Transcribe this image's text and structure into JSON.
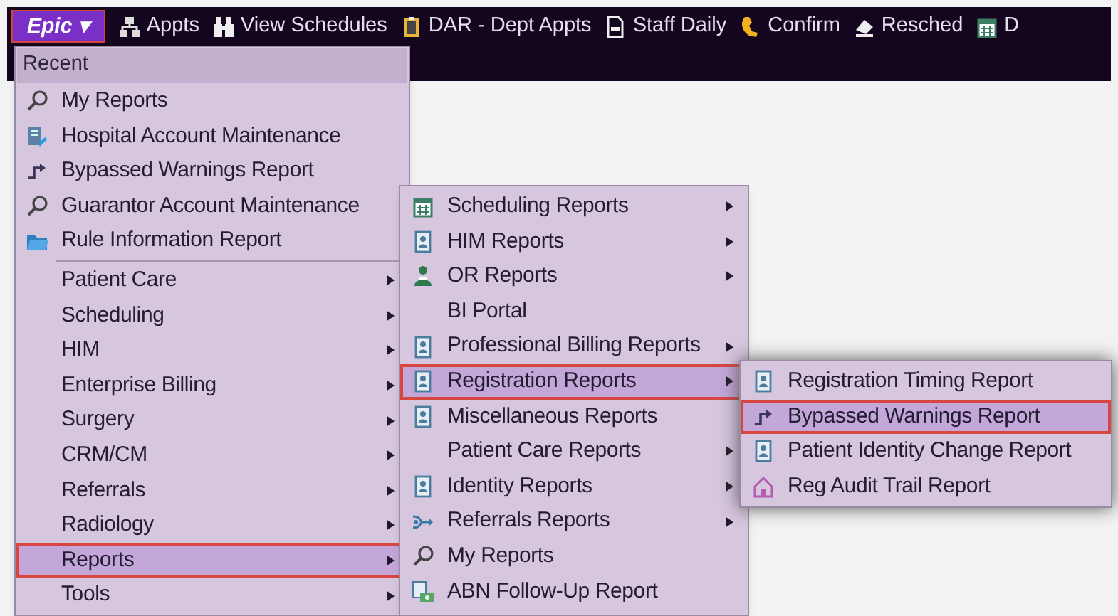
{
  "toolbar": [
    {
      "kind": "epic",
      "label": "Epic ▾"
    },
    {
      "kind": "network",
      "label": "Appts"
    },
    {
      "kind": "binoculars",
      "label": "View Schedules"
    },
    {
      "kind": "clipboard",
      "label": "DAR - Dept Appts"
    },
    {
      "kind": "document",
      "label": "Staff Daily"
    },
    {
      "kind": "phone",
      "label": "Confirm"
    },
    {
      "kind": "eraser",
      "label": "Resched"
    },
    {
      "kind": "calendar",
      "label": "D"
    }
  ],
  "main_menu": {
    "header": "Recent",
    "recent": [
      {
        "kind": "search",
        "label": "My Reports"
      },
      {
        "kind": "edit",
        "label": "Hospital Account Maintenance"
      },
      {
        "kind": "bypass",
        "label": "Bypassed Warnings Report"
      },
      {
        "kind": "search",
        "label": "Guarantor Account Maintenance"
      },
      {
        "kind": "folder",
        "label": "Rule Information Report"
      }
    ],
    "items": [
      {
        "label": "Patient Care",
        "submenu": true,
        "selected": false
      },
      {
        "label": "Scheduling",
        "submenu": true,
        "selected": false
      },
      {
        "label": "HIM",
        "submenu": true,
        "selected": false
      },
      {
        "label": "Enterprise Billing",
        "submenu": true,
        "selected": false
      },
      {
        "label": "Surgery",
        "submenu": true,
        "selected": false
      },
      {
        "label": "CRM/CM",
        "submenu": true,
        "selected": false
      },
      {
        "label": "Referrals",
        "submenu": true,
        "selected": false
      },
      {
        "label": "Radiology",
        "submenu": true,
        "selected": false
      },
      {
        "label": "Reports",
        "submenu": true,
        "selected": true
      },
      {
        "label": "Tools",
        "submenu": true,
        "selected": false
      }
    ]
  },
  "reports_menu": [
    {
      "kind": "calendar",
      "label": "Scheduling Reports",
      "submenu": true,
      "selected": false
    },
    {
      "kind": "report",
      "label": "HIM Reports",
      "submenu": true,
      "selected": false
    },
    {
      "kind": "staff",
      "label": "OR Reports",
      "submenu": true,
      "selected": false
    },
    {
      "kind": "plain",
      "label": "BI Portal",
      "submenu": false,
      "selected": false
    },
    {
      "kind": "report",
      "label": "Professional Billing Reports",
      "submenu": true,
      "selected": false
    },
    {
      "kind": "report",
      "label": "Registration Reports",
      "submenu": true,
      "selected": true
    },
    {
      "kind": "report",
      "label": "Miscellaneous Reports",
      "submenu": false,
      "selected": false
    },
    {
      "kind": "plain",
      "label": "Patient Care Reports",
      "submenu": true,
      "selected": false
    },
    {
      "kind": "report",
      "label": "Identity Reports",
      "submenu": true,
      "selected": false
    },
    {
      "kind": "referral",
      "label": "Referrals Reports",
      "submenu": true,
      "selected": false
    },
    {
      "kind": "search",
      "label": "My Reports",
      "submenu": false,
      "selected": false
    },
    {
      "kind": "abn",
      "label": "ABN Follow-Up Report",
      "submenu": false,
      "selected": false
    }
  ],
  "registration_menu": [
    {
      "kind": "report",
      "label": "Registration Timing Report",
      "selected": false
    },
    {
      "kind": "bypass",
      "label": "Bypassed Warnings Report",
      "selected": true
    },
    {
      "kind": "report",
      "label": "Patient Identity Change Report",
      "selected": false
    },
    {
      "kind": "home",
      "label": "Reg Audit Trail Report",
      "selected": false
    }
  ]
}
